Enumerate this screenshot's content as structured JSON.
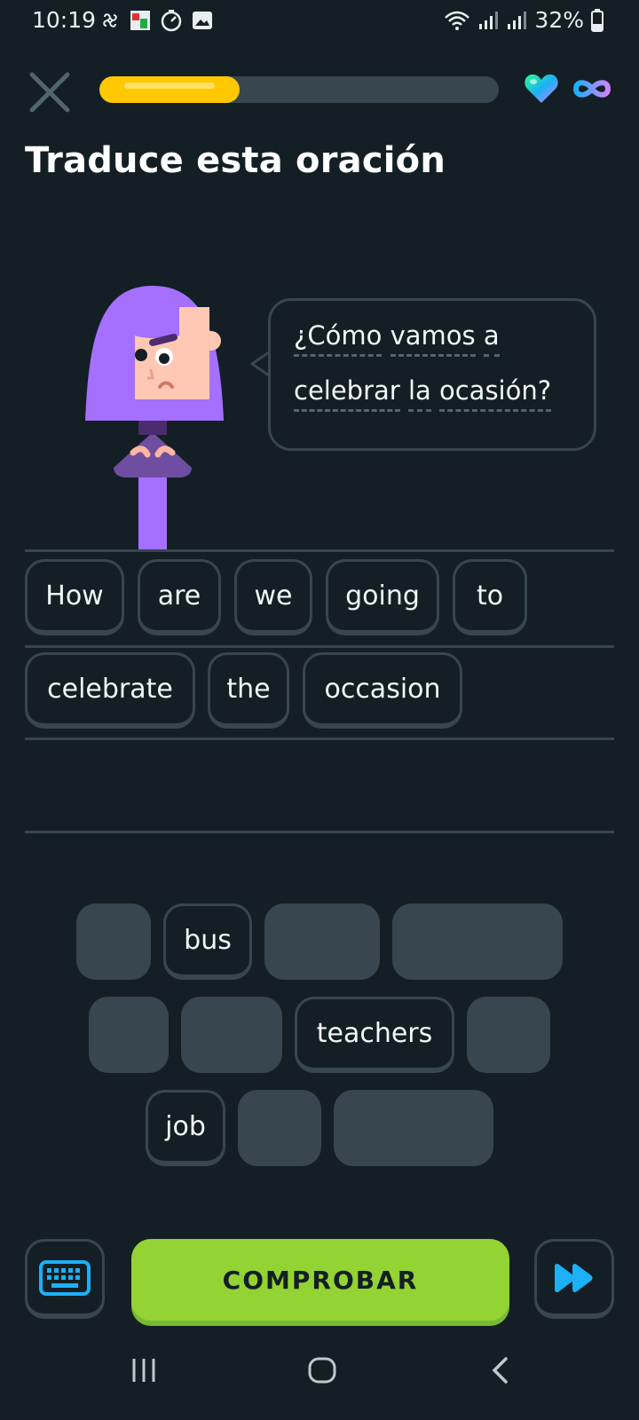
{
  "status_bar": {
    "time": "10:19",
    "battery": "32%"
  },
  "colors": {
    "background": "#131f24",
    "border": "#37464f",
    "progress": "#ffc800",
    "check_button": "#93d333",
    "accent_blue": "#1cb0f6",
    "character_hair": "#a56fff"
  },
  "header": {
    "progress_percent": 35,
    "close_icon": "close-icon",
    "hearts_icon": "heart-icon",
    "hearts_value": "infinity"
  },
  "exercise": {
    "title": "Traduce esta oración",
    "prompt_line1": [
      "¿Cómo",
      "vamos",
      "a"
    ],
    "prompt_line2": [
      "celebrar",
      "la",
      "ocasión?"
    ]
  },
  "answer": {
    "row1": [
      "How",
      "are",
      "we",
      "going",
      "to"
    ],
    "row2": [
      "celebrate",
      "the",
      "occasion"
    ]
  },
  "word_bank": {
    "row1": [
      "",
      "bus",
      "",
      ""
    ],
    "row2": [
      "",
      "",
      "teachers",
      ""
    ],
    "row3": [
      "job",
      "",
      ""
    ]
  },
  "footer": {
    "check_label": "COMPROBAR",
    "keyboard_icon": "keyboard-icon",
    "skip_icon": "fast-forward-icon"
  }
}
